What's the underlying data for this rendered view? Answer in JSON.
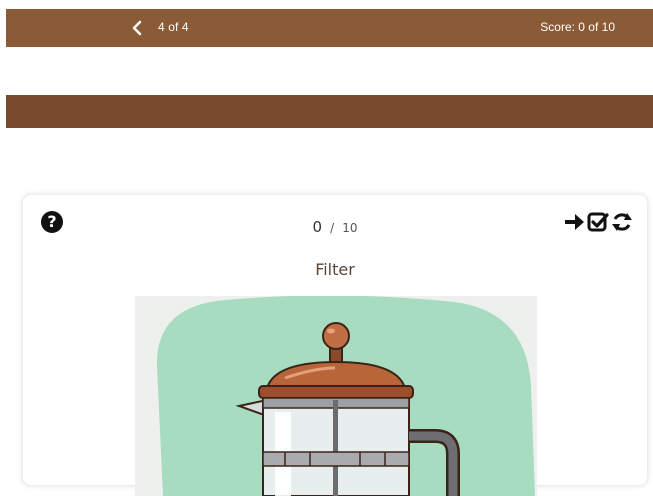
{
  "header": {
    "progress": "4 of 4",
    "score": "Score: 0 of 10"
  },
  "card": {
    "count": "0",
    "separator": "/",
    "total": "10",
    "word": "Filter"
  },
  "icons": {
    "help": "question-circle-icon",
    "back": "chevron-left-icon",
    "next": "arrow-right-icon",
    "check": "check-square-icon",
    "reset": "refresh-icon",
    "image": "french-press-illustration"
  },
  "colors": {
    "header_bg": "#8b5a37",
    "band_bg": "#7a4a2d",
    "illustration_bg": "#a8dcc0"
  }
}
